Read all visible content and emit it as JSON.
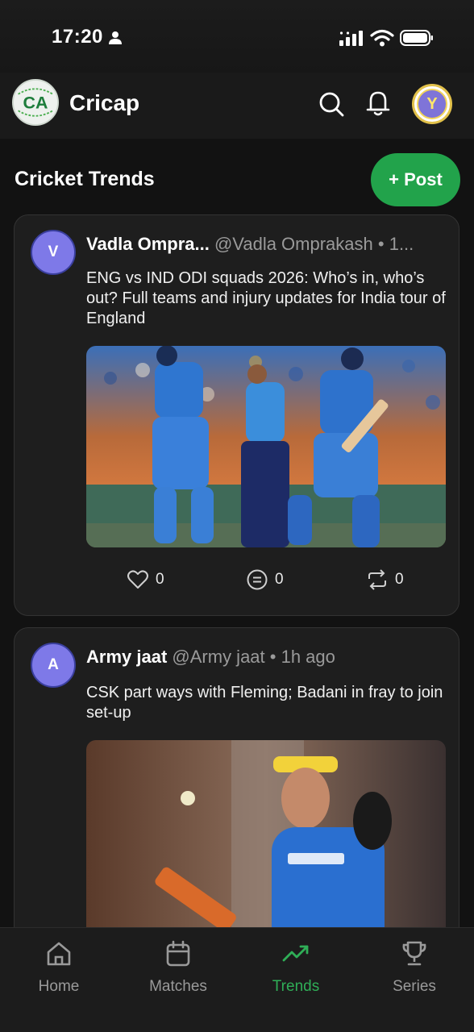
{
  "status_bar": {
    "time": "17:20"
  },
  "header": {
    "logo_text": "CA",
    "app_title": "Cricap",
    "avatar_letter": "Y"
  },
  "page": {
    "title": "Cricket Trends",
    "post_button_label": "+ Post"
  },
  "posts": [
    {
      "avatar_letter": "V",
      "author": "Vadla Ompra...",
      "handle": "@Vadla Omprakash",
      "separator": " • ",
      "time": "1...",
      "text": "ENG vs IND ODI squads 2026: Who’s in, who’s out? Full teams and injury updates for India tour of England",
      "likes": "0",
      "comments": "0",
      "reposts": "0"
    },
    {
      "avatar_letter": "A",
      "author": "Army jaat",
      "handle": "@Army jaat",
      "separator": " • ",
      "time": "1h ago",
      "text": "CSK part ways with Fleming; Badani in fray to join set-up"
    }
  ],
  "bottom_nav": {
    "items": [
      {
        "label": "Home",
        "icon": "home-icon"
      },
      {
        "label": "Matches",
        "icon": "calendar-icon"
      },
      {
        "label": "Trends",
        "icon": "trending-icon"
      },
      {
        "label": "Series",
        "icon": "trophy-icon"
      }
    ],
    "active": "Trends"
  },
  "colors": {
    "background": "#121212",
    "card": "#1e1e1e",
    "accent": "#22a34b",
    "avatar_purple": "#7e79e8",
    "muted_text": "#9a9a9a"
  }
}
